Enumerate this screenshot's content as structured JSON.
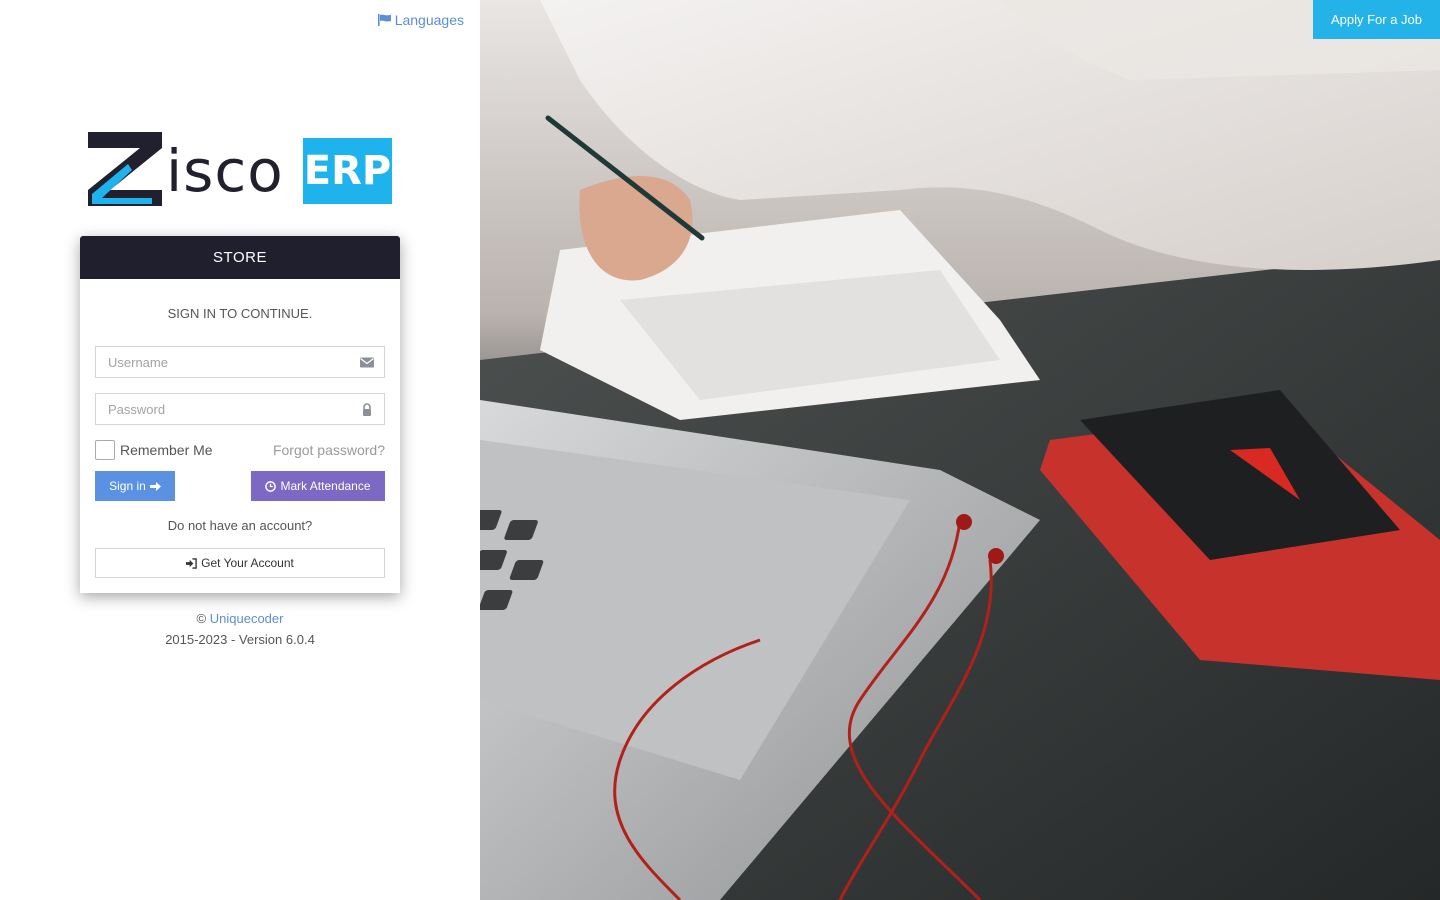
{
  "header": {
    "languages_label": "Languages",
    "apply_job_label": "Apply For a Job"
  },
  "brand": {
    "logo_text": "isco",
    "logo_badge": "ERP",
    "colors": {
      "dark": "#20202e",
      "accent": "#1fb3ee"
    }
  },
  "login_card": {
    "title": "STORE",
    "subtitle": "SIGN IN TO CONTINUE.",
    "username_placeholder": "Username",
    "password_placeholder": "Password",
    "remember_label": "Remember Me",
    "forgot_label": "Forgot password?",
    "signin_label": "Sign in",
    "attendance_label": "Mark Attendance",
    "no_account_text": "Do not have an account?",
    "get_account_label": "Get Your Account"
  },
  "footer": {
    "copyright_symbol": "©",
    "company": "Uniquecoder",
    "version_text": "2015-2023 - Version 6.0.4"
  },
  "colors": {
    "link": "#5b8fd6",
    "signin_button": "#5b91e3",
    "attendance_button": "#7c69c3",
    "card_header": "#201f2e",
    "apply_button": "#23b3e8"
  },
  "icons": {
    "languages": "flag-icon",
    "username": "envelope-icon",
    "password": "lock-icon",
    "signin": "arrow-right-icon",
    "attendance": "clock-icon",
    "get_account": "sign-in-icon"
  }
}
